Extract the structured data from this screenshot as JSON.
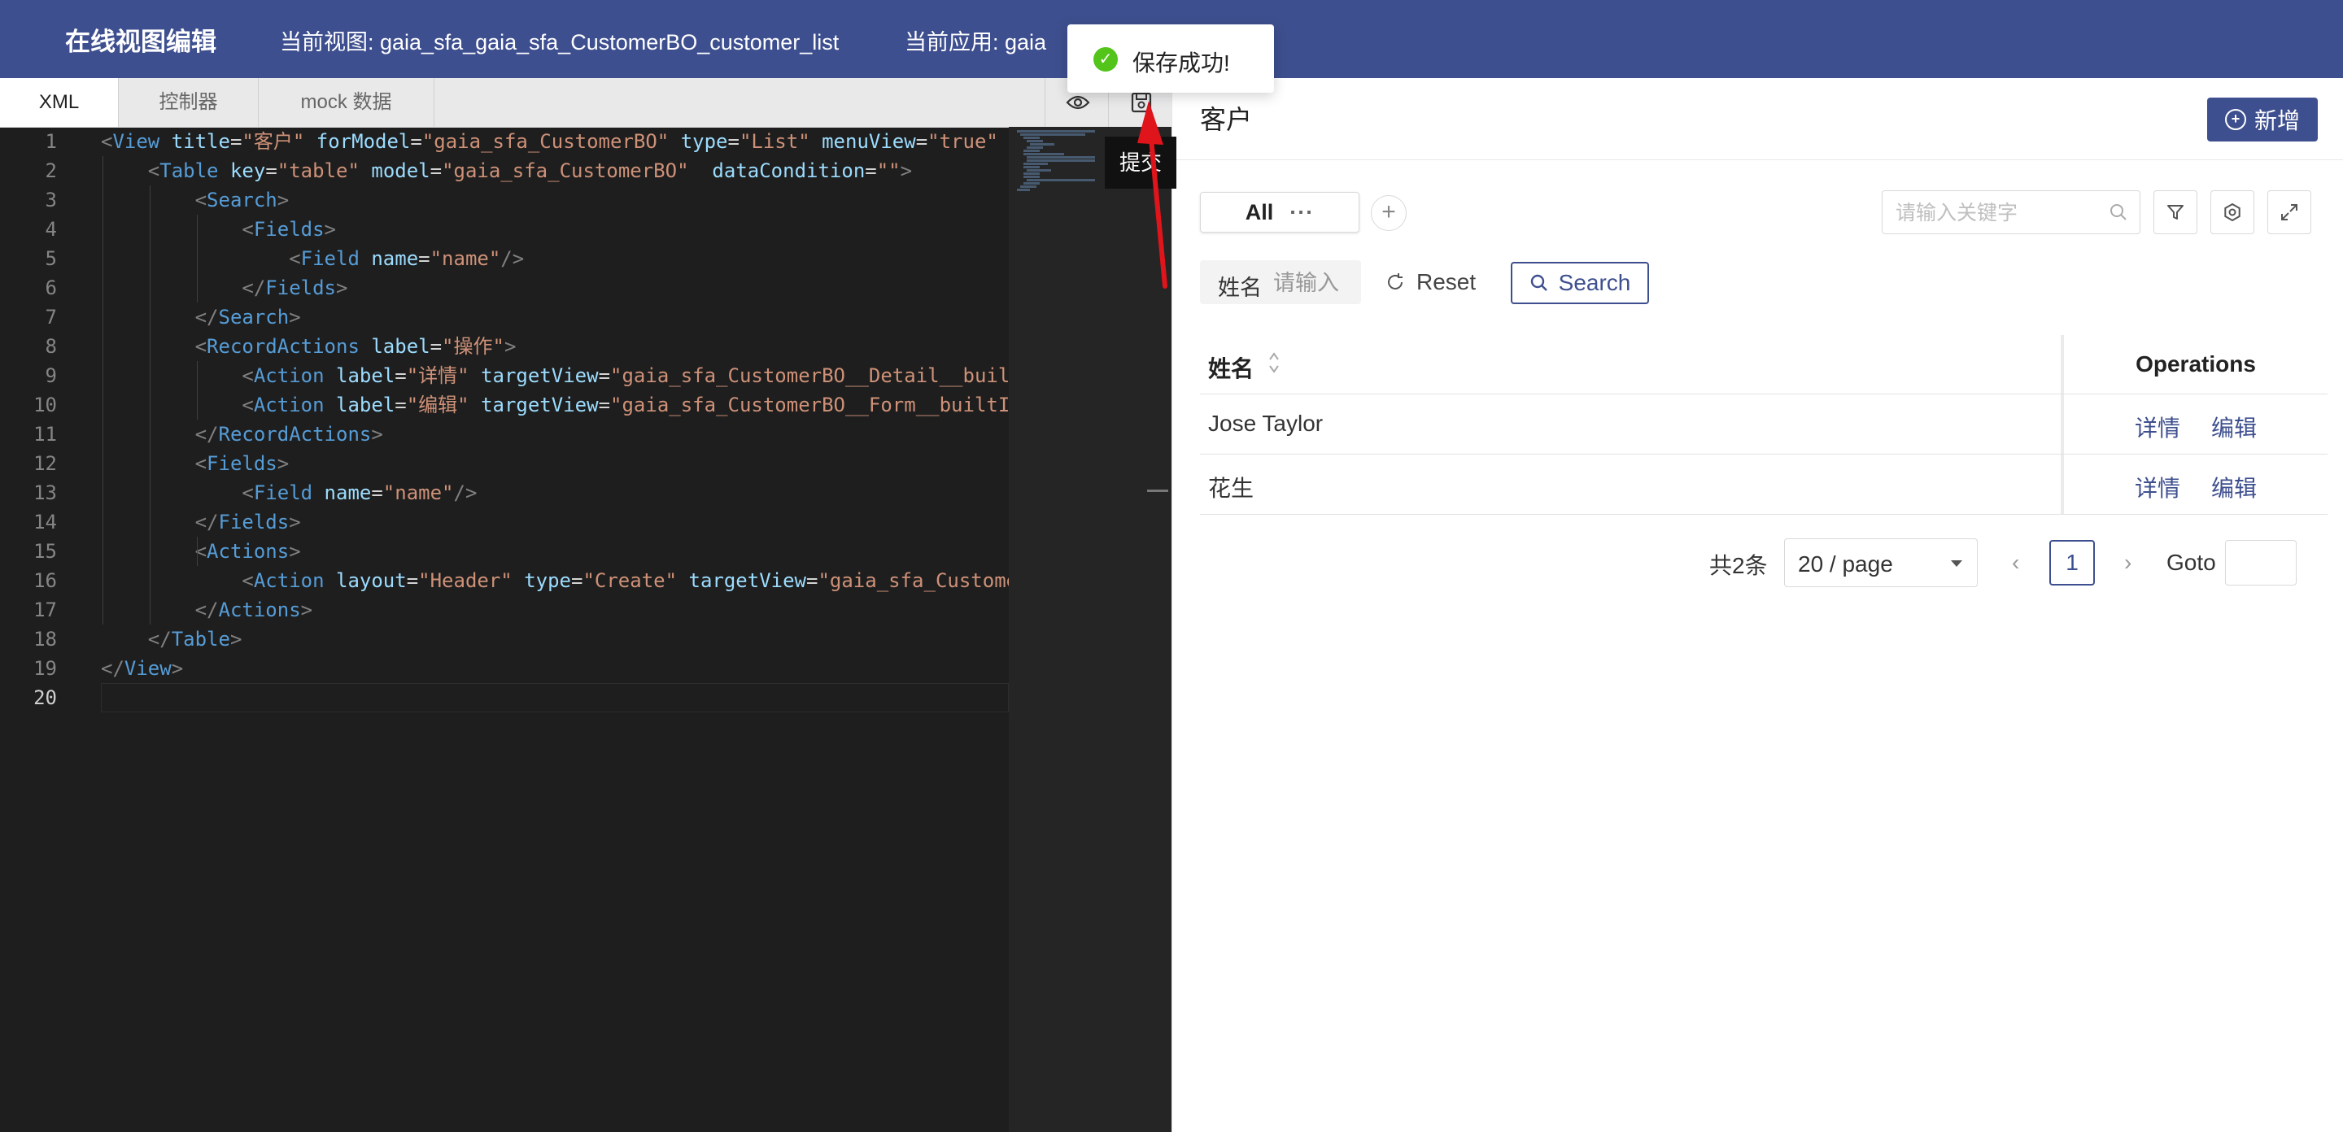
{
  "header": {
    "app_title": "在线视图编辑",
    "current_view": "当前视图: gaia_sfa_gaia_sfa_CustomerBO_customer_list",
    "current_app": "当前应用: gaia"
  },
  "toast": {
    "message": "保存成功!"
  },
  "editor": {
    "tabs": [
      {
        "label": "XML",
        "active": true
      },
      {
        "label": "控制器",
        "active": false
      },
      {
        "label": "mock 数据",
        "active": false
      }
    ],
    "tooltip": "提交",
    "line_numbers": [
      "1",
      "2",
      "3",
      "4",
      "5",
      "6",
      "7",
      "8",
      "9",
      "10",
      "11",
      "12",
      "13",
      "14",
      "15",
      "16",
      "17",
      "18",
      "19",
      "20"
    ],
    "current_line": 20,
    "code": [
      "<View title=\"客户\" forModel=\"gaia_sfa_CustomerBO\" type=\"List\" menuView=\"true\"",
      "    <Table key=\"table\" model=\"gaia_sfa_CustomerBO\"  dataCondition=\"\">",
      "        <Search>",
      "            <Fields>",
      "                <Field name=\"name\"/>",
      "            </Fields>",
      "        </Search>",
      "        <RecordActions label=\"操作\">",
      "            <Action label=\"详情\" targetView=\"gaia_sfa_CustomerBO__Detail__buil",
      "            <Action label=\"编辑\" targetView=\"gaia_sfa_CustomerBO__Form__builtI",
      "        </RecordActions>",
      "        <Fields>",
      "            <Field name=\"name\"/>",
      "        </Fields>",
      "        <Actions>",
      "            <Action layout=\"Header\" type=\"Create\" targetView=\"gaia_sfa_Custome",
      "        </Actions>",
      "    </Table>",
      "</View>",
      ""
    ]
  },
  "preview": {
    "title": "客户",
    "add_button": "新增",
    "view_tab": {
      "label": "All",
      "more": "···"
    },
    "keyword_placeholder": "请输入关键字",
    "search_field": {
      "label": "姓名",
      "placeholder": "请输入"
    },
    "reset_label": "Reset",
    "search_label": "Search",
    "table": {
      "columns": [
        "姓名",
        "Operations"
      ],
      "rows": [
        {
          "name": "Jose Taylor",
          "ops": [
            "详情",
            "编辑"
          ]
        },
        {
          "name": "花生",
          "ops": [
            "详情",
            "编辑"
          ]
        }
      ]
    },
    "pagination": {
      "total": "共2条",
      "page_size": "20 / page",
      "prev": "‹",
      "next": "›",
      "current_page": "1",
      "goto_label": "Goto"
    }
  },
  "colors": {
    "brand": "#3e4f8f",
    "editor_bg": "#1e1e1e",
    "success": "#52c41a",
    "annotation_arrow": "#e0141b"
  }
}
